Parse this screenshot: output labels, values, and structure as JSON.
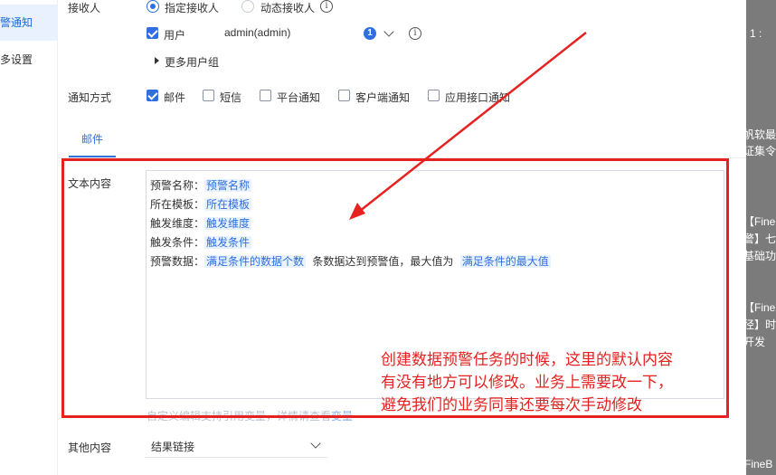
{
  "nav": {
    "items": [
      {
        "label": "预警通知",
        "active": true
      },
      {
        "label": "更多设置",
        "active": false
      }
    ]
  },
  "form": {
    "receiver": {
      "label": "接收人",
      "options": [
        "指定接收人",
        "动态接收人"
      ],
      "selected": "指定接收人"
    },
    "user": {
      "label": "用户",
      "checked": true,
      "value": "admin(admin)",
      "count": "1"
    },
    "more_groups": "更多用户组",
    "notify": {
      "label": "通知方式",
      "options": [
        {
          "label": "邮件",
          "checked": true
        },
        {
          "label": "短信",
          "checked": false
        },
        {
          "label": "平台通知",
          "checked": false
        },
        {
          "label": "客户端通知",
          "checked": false
        },
        {
          "label": "应用接口通知",
          "checked": false
        }
      ]
    },
    "tab_label": "邮件",
    "text_content": {
      "label": "文本内容",
      "lines": [
        {
          "prefix": "预警名称：",
          "var": "预警名称"
        },
        {
          "prefix": "所在模板：",
          "var": "所在模板"
        },
        {
          "prefix": "触发维度：",
          "var": "触发维度"
        },
        {
          "prefix": "触发条件：",
          "var": "触发条件"
        }
      ],
      "data_line": {
        "prefix": "预警数据：",
        "var1": "满足条件的数据个数",
        "middle": "条数据达到预警值，最大值为",
        "var2": "满足条件的最大值"
      },
      "hint": "自定义编辑支持引用变量，详情请查看",
      "hint_link": "变量"
    },
    "other": {
      "label": "其他内容",
      "value": "结果链接"
    }
  },
  "annotation": {
    "lines": [
      "创建数据预警任务的时候，这里的默认内容",
      "有没有地方可以修改。业务上需要改一下，",
      "避免我们的业务同事还要每次手动修改"
    ]
  },
  "overlay": {
    "texts": [
      "：1 :",
      "帆软最",
      "证集令",
      "【Fine",
      "警】七",
      "基础功",
      "【Fine",
      "径】时",
      "开发",
      "FineB"
    ]
  },
  "colors": {
    "accent": "#2f6fde",
    "annotation_red": "#e52220"
  }
}
